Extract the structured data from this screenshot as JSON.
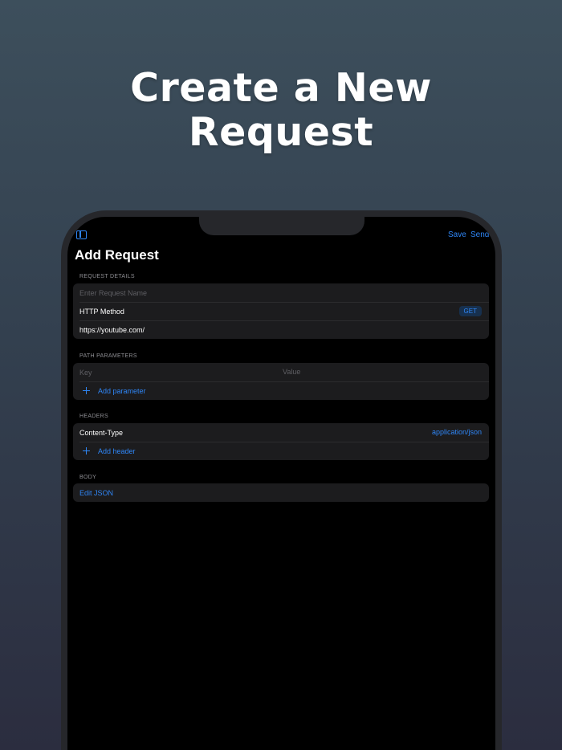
{
  "headline": {
    "line1": "Create a New",
    "line2": "Request"
  },
  "nav": {
    "save_label": "Save",
    "send_label": "Send",
    "title": "Add Request"
  },
  "request_details": {
    "header": "REQUEST DETAILS",
    "name_placeholder": "Enter Request Name",
    "method_label": "HTTP Method",
    "method_value": "GET",
    "url_value": "https://youtube.com/"
  },
  "path_parameters": {
    "header": "PATH PARAMETERS",
    "key_placeholder": "Key",
    "value_placeholder": "Value",
    "add_label": "Add parameter"
  },
  "headers": {
    "header": "HEADERS",
    "items": [
      {
        "key": "Content-Type",
        "value": "application/json"
      }
    ],
    "add_label": "Add header"
  },
  "body": {
    "header": "BODY",
    "edit_label": "Edit JSON"
  },
  "colors": {
    "accent": "#2f86f6",
    "background": "#000000",
    "cell": "#1c1c1e"
  }
}
